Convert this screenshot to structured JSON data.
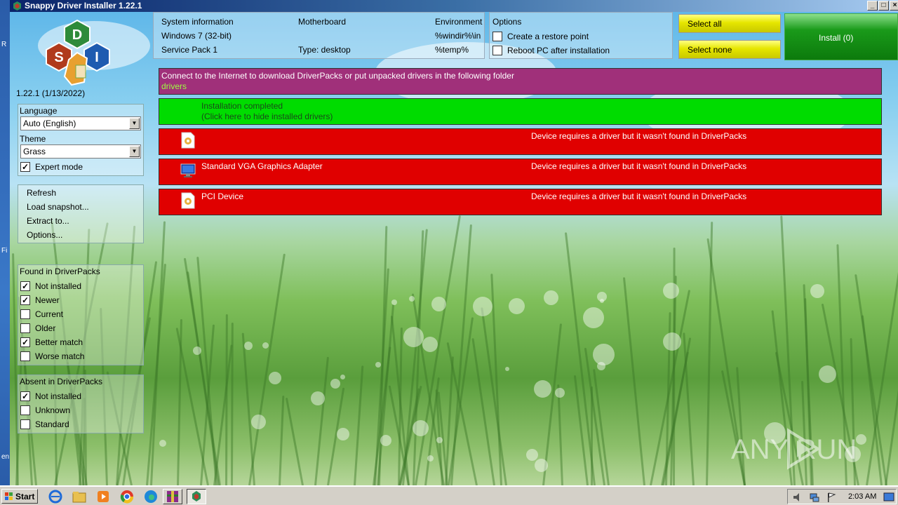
{
  "window": {
    "title": "Snappy Driver Installer 1.22.1"
  },
  "desktop_fragments": [
    "R",
    "Fi",
    "en"
  ],
  "left_panel": {
    "logo_letters": [
      "D",
      "S",
      "I"
    ],
    "version": "1.22.1 (1/13/2022)",
    "language_label": "Language",
    "language_value": "Auto (English)",
    "theme_label": "Theme",
    "theme_value": "Grass",
    "expert_mode_label": "Expert mode",
    "expert_mode_checked": true,
    "menu": [
      "Refresh",
      "Load snapshot...",
      "Extract to...",
      "Options..."
    ],
    "found_header": "Found in DriverPacks",
    "found_filters": [
      {
        "label": "Not installed",
        "checked": true
      },
      {
        "label": "Newer",
        "checked": true
      },
      {
        "label": "Current",
        "checked": false
      },
      {
        "label": "Older",
        "checked": false
      },
      {
        "label": "Better match",
        "checked": true
      },
      {
        "label": "Worse match",
        "checked": false
      }
    ],
    "absent_header": "Absent in DriverPacks",
    "absent_filters": [
      {
        "label": "Not installed",
        "checked": true
      },
      {
        "label": "Unknown",
        "checked": false
      },
      {
        "label": "Standard",
        "checked": false
      }
    ]
  },
  "system_info": {
    "col1": [
      "System information",
      "Windows 7 (32-bit)",
      "Service Pack 1"
    ],
    "col2": [
      "Motherboard",
      "",
      "Type: desktop"
    ],
    "col3": [
      "Environment",
      "%windir%\\in",
      "%temp%"
    ]
  },
  "options": {
    "header": "Options",
    "items": [
      {
        "label": "Create a restore point",
        "checked": false
      },
      {
        "label": "Reboot PC after installation",
        "checked": false
      }
    ]
  },
  "buttons": {
    "select_all": "Select all",
    "select_none": "Select none",
    "install": "Install (0)"
  },
  "rows": {
    "notice_line1": "Connect to the Internet to download DriverPacks or put unpacked drivers in the following folder",
    "notice_line2": "drivers",
    "completed_line1": "Installation completed",
    "completed_line2": "(Click here to hide installed drivers)",
    "devices": [
      {
        "name": "",
        "status": "Device requires a driver but it wasn't found in DriverPacks",
        "icon": "unknown-device-icon"
      },
      {
        "name": "Standard VGA Graphics Adapter",
        "status": "Device requires a driver but it wasn't found in DriverPacks",
        "icon": "monitor-icon"
      },
      {
        "name": "PCI Device",
        "status": "Device requires a driver but it wasn't found in DriverPacks",
        "icon": "unknown-device-icon"
      }
    ]
  },
  "watermark": "ANY RUN",
  "taskbar": {
    "start_label": "Start",
    "clock": "2:03 AM"
  },
  "colors": {
    "notice_row": "#a0307a",
    "completed_row": "#00dc00",
    "error_row": "#e00000",
    "notice_path_text": "#9cff40",
    "select_button": "#e6e600",
    "install_button": "#1a9a1a"
  }
}
